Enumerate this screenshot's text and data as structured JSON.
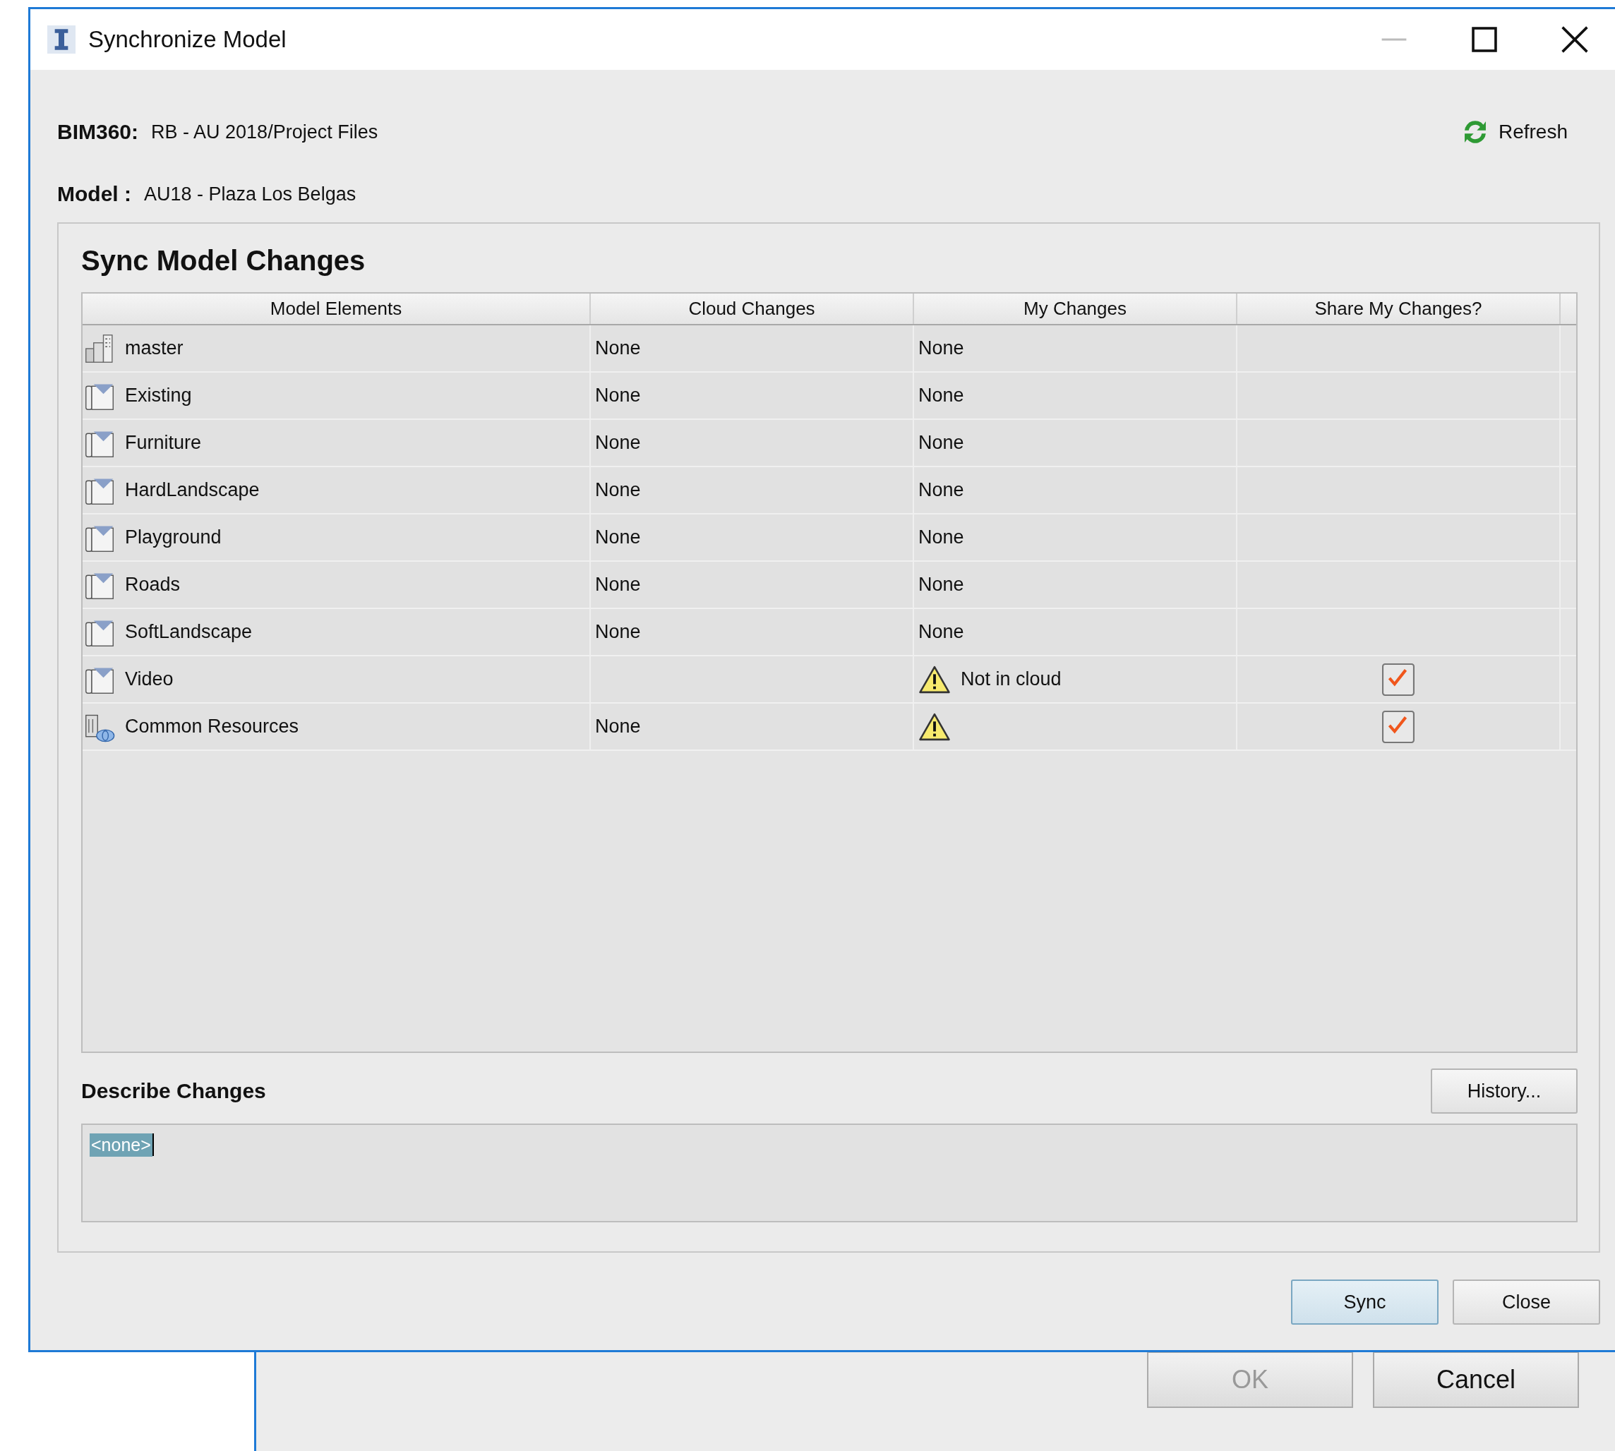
{
  "window": {
    "title": "Synchronize Model"
  },
  "location": {
    "label": "BIM360:",
    "value": "RB - AU 2018/Project Files"
  },
  "model": {
    "label": "Model :",
    "value": "AU18 - Plaza Los Belgas"
  },
  "refresh_button": "Refresh",
  "group_title": "Sync Model Changes",
  "table": {
    "columns": [
      "Model Elements",
      "Cloud Changes",
      "My Changes",
      "Share My Changes?"
    ],
    "rows": [
      {
        "kind": "host",
        "name": "master",
        "cloud_changes": "None",
        "my_changes": "None",
        "warning": false
      },
      {
        "kind": "linked",
        "name": "Existing",
        "cloud_changes": "None",
        "my_changes": "None",
        "warning": false
      },
      {
        "kind": "linked",
        "name": "Furniture",
        "cloud_changes": "None",
        "my_changes": "None",
        "warning": false
      },
      {
        "kind": "linked",
        "name": "HardLandscape",
        "cloud_changes": "None",
        "my_changes": "None",
        "warning": false
      },
      {
        "kind": "linked",
        "name": "Playground",
        "cloud_changes": "None",
        "my_changes": "None",
        "warning": false
      },
      {
        "kind": "linked",
        "name": "Roads",
        "cloud_changes": "None",
        "my_changes": "None",
        "warning": false
      },
      {
        "kind": "linked",
        "name": "SoftLandscape",
        "cloud_changes": "None",
        "my_changes": "None",
        "warning": false
      },
      {
        "kind": "linked",
        "name": "Video",
        "my_changes": "Not in cloud",
        "warning": true,
        "share": {
          "checked": true
        }
      },
      {
        "kind": "resources",
        "name": "Common Resources",
        "cloud_changes": "None",
        "warning": true,
        "share": {
          "checked": true
        }
      }
    ]
  },
  "describe": {
    "label": "Describe Changes",
    "history_button": "History...",
    "text": "<none>",
    "text_selected": true
  },
  "buttons": [
    {
      "label": "Sync",
      "default": true
    },
    {
      "label": "Close",
      "default": false
    }
  ],
  "background_window": {
    "buttons": [
      {
        "label": "OK",
        "disabled": true
      },
      {
        "label": "Cancel",
        "disabled": false
      }
    ]
  }
}
